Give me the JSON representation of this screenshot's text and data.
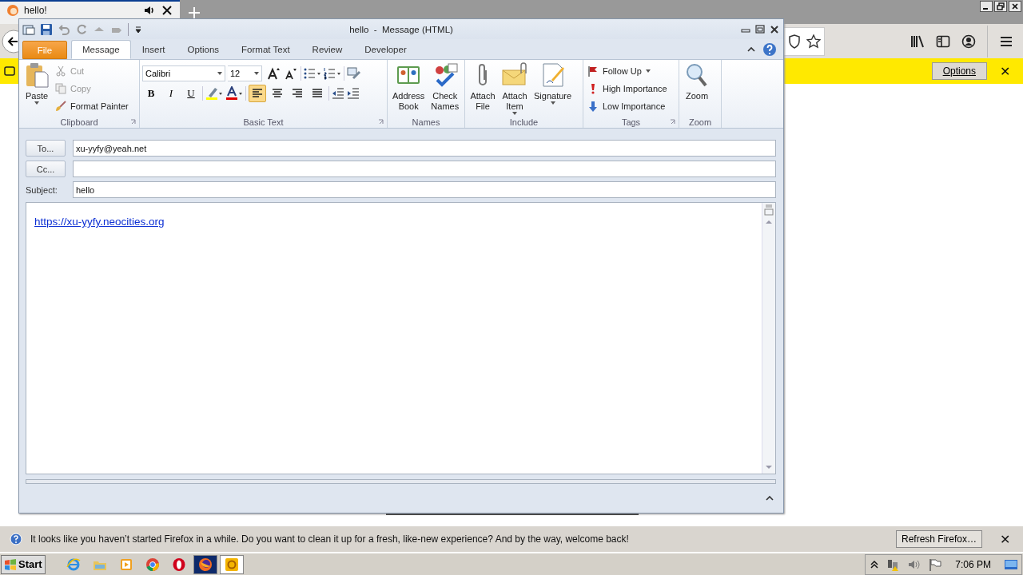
{
  "browser": {
    "tab": {
      "title": "hello!"
    },
    "infobar": {
      "button": "Options",
      "close": "✕"
    },
    "notification": {
      "message": "It looks like you haven’t started Firefox in a while. Do you want to clean it up for a fresh, like-new experience? And by the way, welcome back!",
      "button": "Refresh Firefox…",
      "close": "✕"
    }
  },
  "outlook": {
    "title": "hello  -  Message (HTML)",
    "tabs": [
      {
        "label": "File",
        "kind": "file",
        "selected": false
      },
      {
        "label": "Message",
        "kind": "tab",
        "selected": true
      },
      {
        "label": "Insert",
        "kind": "tab",
        "selected": false
      },
      {
        "label": "Options",
        "kind": "tab",
        "selected": false
      },
      {
        "label": "Format Text",
        "kind": "tab",
        "selected": false
      },
      {
        "label": "Review",
        "kind": "tab",
        "selected": false
      },
      {
        "label": "Developer",
        "kind": "tab",
        "selected": false
      }
    ],
    "ribbon": {
      "clipboard": {
        "label": "Clipboard",
        "paste": "Paste",
        "items": [
          {
            "label": "Cut",
            "kind": "cut",
            "disabled": true
          },
          {
            "label": "Copy",
            "kind": "copy",
            "disabled": true
          },
          {
            "label": "Format Painter",
            "kind": "painter",
            "disabled": false
          }
        ]
      },
      "basic_text": {
        "label": "Basic Text",
        "font": "Calibri",
        "size": "12",
        "styles": [
          "B",
          "I",
          "U"
        ],
        "alignments": [
          {
            "kind": "left",
            "selected": true
          },
          {
            "kind": "center",
            "selected": false
          },
          {
            "kind": "right",
            "selected": false
          },
          {
            "kind": "justify",
            "selected": false
          }
        ]
      },
      "names": {
        "label": "Names",
        "buttons": [
          {
            "lines": [
              "Address",
              "Book"
            ],
            "kind": "book"
          },
          {
            "lines": [
              "Check",
              "Names"
            ],
            "kind": "check"
          }
        ]
      },
      "include": {
        "label": "Include",
        "buttons": [
          {
            "lines": [
              "Attach",
              "File"
            ],
            "kind": "clip",
            "dropdown": false
          },
          {
            "lines": [
              "Attach",
              "Item"
            ],
            "kind": "envelope",
            "dropdown": true
          },
          {
            "lines": [
              "Signature"
            ],
            "kind": "signature",
            "dropdown": true
          }
        ]
      },
      "tags": {
        "label": "Tags",
        "items": [
          {
            "label": "Follow Up",
            "kind": "flag",
            "dropdown": true
          },
          {
            "label": "High Importance",
            "kind": "high",
            "dropdown": false
          },
          {
            "label": "Low Importance",
            "kind": "low",
            "dropdown": false
          }
        ]
      },
      "zoom": {
        "label": "Zoom",
        "button": "Zoom"
      }
    },
    "form": {
      "to": {
        "button": "To...",
        "value": "xu-yyfy@yeah.net"
      },
      "cc": {
        "button": "Cc..."
      },
      "subject": {
        "label": "Subject:",
        "value": "hello"
      }
    },
    "body": {
      "link": "https://xu-yyfy.neocities.org"
    }
  },
  "taskbar": {
    "start": "Start",
    "apps": [
      {
        "kind": "ie",
        "selected": false
      },
      {
        "kind": "explorer",
        "selected": false
      },
      {
        "kind": "media",
        "selected": false
      },
      {
        "kind": "chrome",
        "selected": false
      },
      {
        "kind": "opera",
        "selected": false
      },
      {
        "kind": "firefox",
        "selected": true
      },
      {
        "kind": "outlook",
        "selected": true
      }
    ],
    "time": "7:06 PM"
  }
}
